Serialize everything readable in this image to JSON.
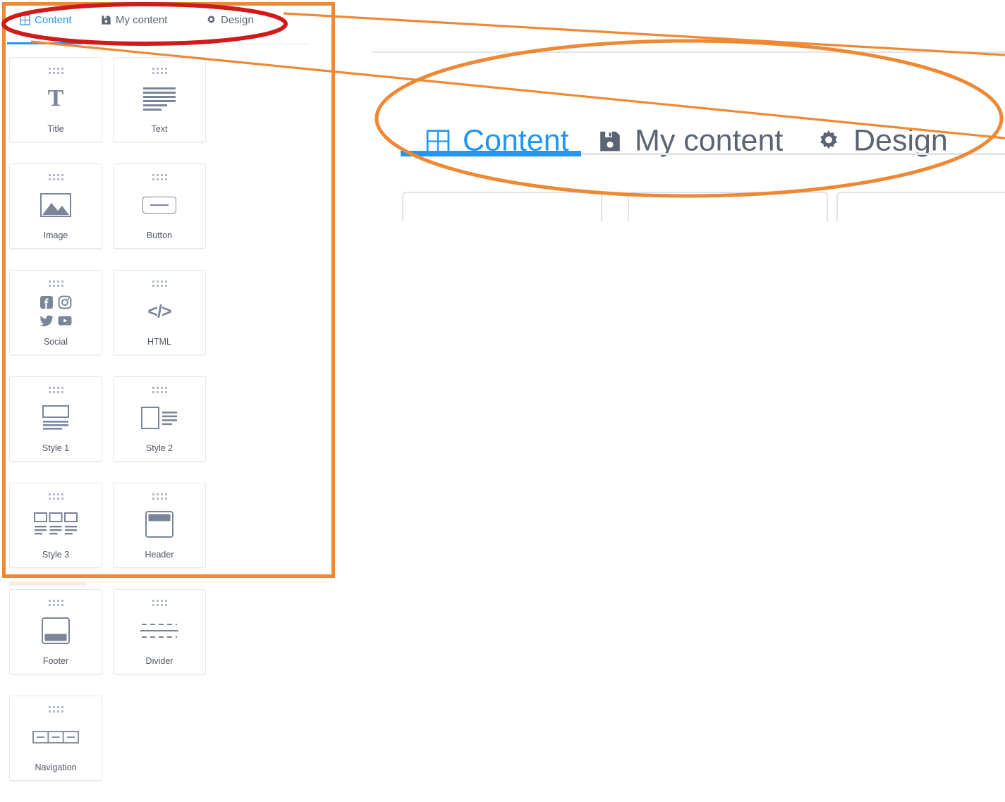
{
  "editor": {
    "tabs": [
      {
        "label": "Content",
        "icon": "grid-icon",
        "active": true,
        "color": "#2196f3"
      },
      {
        "label": "My content",
        "icon": "save-icon",
        "active": false,
        "color": "#5b6472"
      },
      {
        "label": "Design",
        "icon": "gear-icon",
        "active": false,
        "color": "#5b6472"
      }
    ],
    "blocks": [
      {
        "label": "Title",
        "icon": "title-text-icon"
      },
      {
        "label": "Text",
        "icon": "paragraph-lines-icon"
      },
      {
        "label": "Image",
        "icon": "image-icon"
      },
      {
        "label": "Button",
        "icon": "button-icon"
      },
      {
        "label": "Social",
        "icon": "social-networks-icon"
      },
      {
        "label": "HTML",
        "icon": "code-icon"
      },
      {
        "label": "Style 1",
        "icon": "layout-style-1-icon"
      },
      {
        "label": "Style 2",
        "icon": "layout-style-2-icon"
      },
      {
        "label": "Style 3",
        "icon": "layout-style-3-icon"
      },
      {
        "label": "Header",
        "icon": "header-layout-icon"
      },
      {
        "label": "Footer",
        "icon": "footer-layout-icon"
      },
      {
        "label": "Divider",
        "icon": "divider-icon"
      },
      {
        "label": "Navigation",
        "icon": "navigation-icon"
      }
    ]
  },
  "magnified": {
    "tabs": [
      {
        "label": "Content",
        "icon": "grid-icon",
        "active": true
      },
      {
        "label": "My content",
        "icon": "save-icon",
        "active": false
      },
      {
        "label": "Design",
        "icon": "gear-icon",
        "active": false
      }
    ]
  },
  "annotations": {
    "selection_box_color": "#ef8833",
    "ellipse_small_color": "#d11a1a",
    "ellipse_large_color": "#ef8833",
    "leader_line_color": "#ef8833"
  },
  "colors": {
    "accent_blue": "#2196f3",
    "icon_gray": "#7a8599",
    "text_gray": "#5b6472",
    "border_gray": "#e3e7ec",
    "orange": "#ef8833",
    "red": "#d11a1a"
  }
}
